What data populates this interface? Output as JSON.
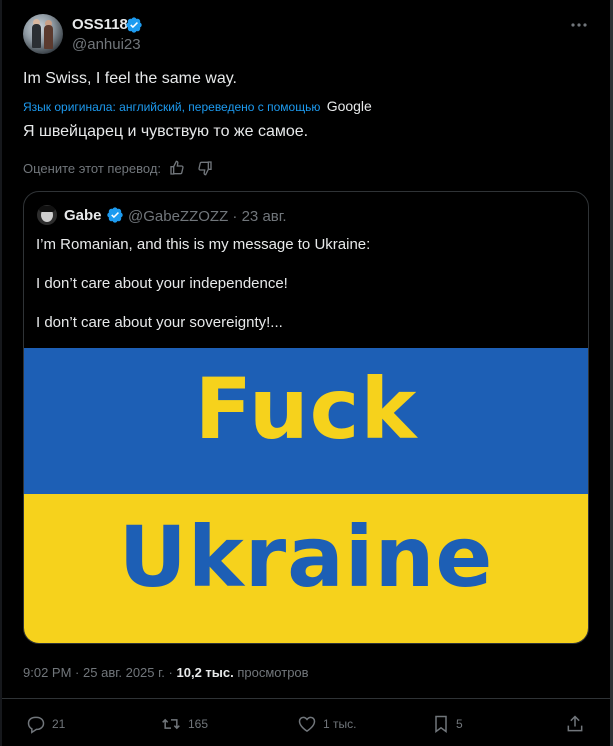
{
  "author": {
    "display_name": "OSS118",
    "handle": "@anhui23"
  },
  "tweet": {
    "text": "Im Swiss, I feel the same way.",
    "translate_note": "Язык оригинала: английский, переведено с помощью",
    "translate_provider": "Google",
    "translated_text": "Я швейцарец и чувствую то же самое.",
    "rate_label": "Оцените этот перевод:"
  },
  "quote": {
    "display_name": "Gabe",
    "handle": "@GabeZZOZZ",
    "separator": "·",
    "date": "23 авг.",
    "lines": [
      "I’m Romanian, and this is my message to Ukraine:",
      "I don’t care about your independence!",
      "I don’t care about your sovereignty!..."
    ],
    "image_text": {
      "top": "Fuck",
      "bottom": "Ukraine"
    },
    "image_colors": {
      "blue": "#1d5fb5",
      "yellow": "#f6d21c"
    }
  },
  "meta": {
    "time": "9:02 PM",
    "date": "25 авг. 2025 г.",
    "dot": "·",
    "views_count": "10,2 тыс.",
    "views_label": "просмотров"
  },
  "actions": {
    "replies": "21",
    "reposts": "165",
    "likes": "1 тыс.",
    "bookmarks": "5"
  },
  "colors": {
    "background": "#000000",
    "text": "#e7e9ea",
    "muted": "#71767b",
    "accent": "#1d9bf0",
    "border": "#2f3336"
  },
  "icons": [
    "verified-badge-icon",
    "more-icon",
    "thumbs-up-icon",
    "thumbs-down-icon",
    "reply-icon",
    "repost-icon",
    "like-icon",
    "bookmark-icon",
    "share-icon"
  ]
}
